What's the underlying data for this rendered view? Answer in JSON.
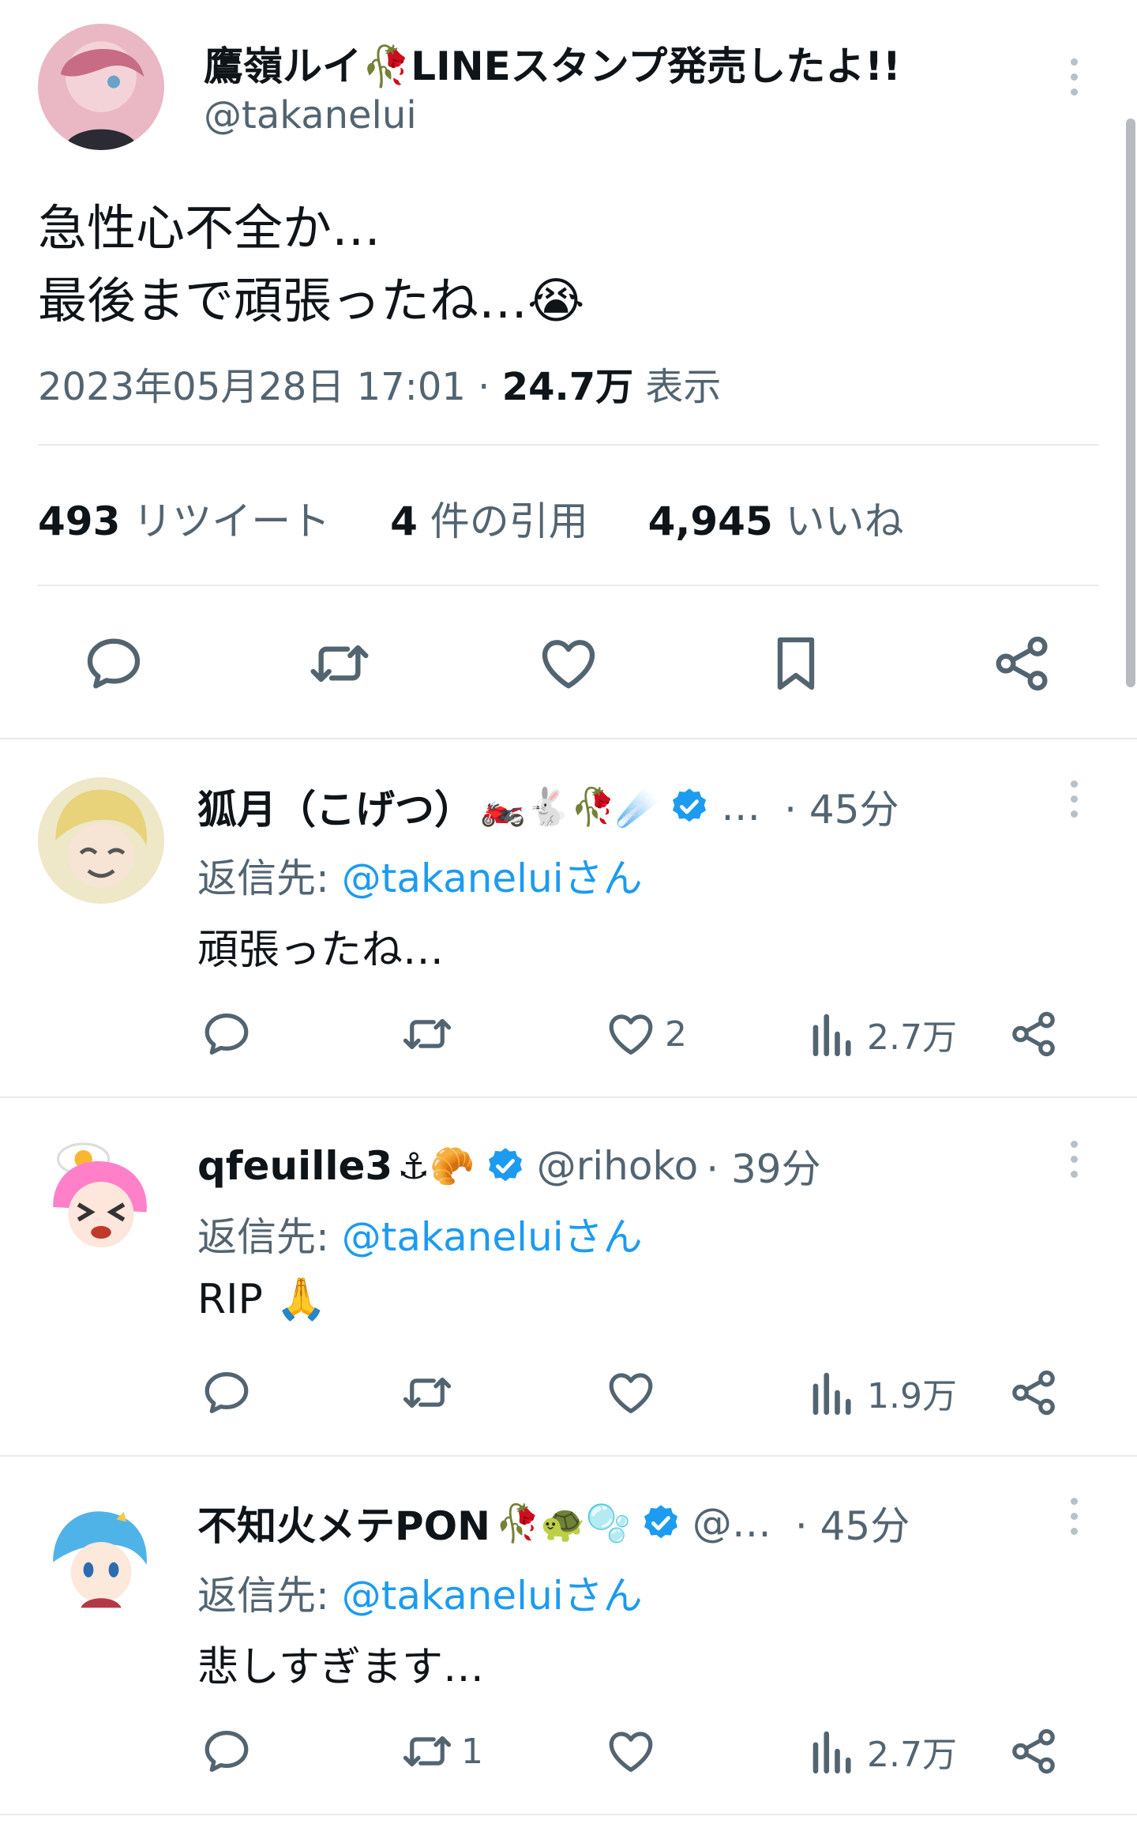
{
  "main_tweet": {
    "display_name": "鷹嶺ルイ🥀LINEスタンプ発売したよ!!",
    "handle": "@takanelui",
    "text_line1": "急性心不全か…",
    "text_line2": "最後まで頑張ったね…😭",
    "date": "2023年05月28日 17:01",
    "separator": "·",
    "views_count": "24.7万",
    "views_label": "表示",
    "retweets_count": "493",
    "retweets_label": "リツイート",
    "quotes_count": "4",
    "quotes_label": "件の引用",
    "likes_count": "4,945",
    "likes_label": "いいね"
  },
  "replies": [
    {
      "display_name": "狐月（こげつ）",
      "emojis": "🏍️🐇🥀☄️",
      "handle": "…",
      "time": "· 45分",
      "reply_to_label": "返信先:",
      "reply_to_handle": "@takaneluiさん",
      "text": "頑張ったね…",
      "likes": "2",
      "retweets": "",
      "views": "2.7万"
    },
    {
      "display_name": "qfeuille3",
      "emojis": "⚓🥐",
      "handle": "@rihoko",
      "time": "· 39分",
      "reply_to_label": "返信先:",
      "reply_to_handle": "@takaneluiさん",
      "text": "RIP 🙏",
      "likes": "",
      "retweets": "",
      "views": "1.9万"
    },
    {
      "display_name": "不知火メテPON",
      "emojis": "🥀🐢🫧",
      "handle": "@…",
      "time": "· 45分",
      "reply_to_label": "返信先:",
      "reply_to_handle": "@takaneluiさん",
      "text": "悲しすぎます…",
      "likes": "",
      "retweets": "1",
      "views": "2.7万"
    }
  ],
  "colors": {
    "text": "#0f1419",
    "muted": "#536471",
    "link": "#1d9bf0",
    "verified": "#1d9bf0",
    "divider": "#e7e9ea"
  },
  "icons": [
    "reply-icon",
    "retweet-icon",
    "like-icon",
    "bookmark-icon",
    "share-icon",
    "views-icon",
    "more-icon",
    "verified-icon"
  ]
}
